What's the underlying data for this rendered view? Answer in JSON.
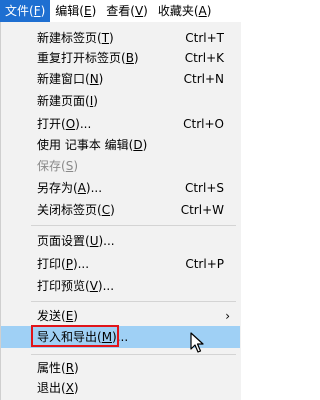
{
  "menubar": [
    {
      "name": "menu-file",
      "label": "文件(",
      "key": "F",
      "close": ")",
      "active": true
    },
    {
      "name": "menu-edit",
      "label": "编辑(",
      "key": "E",
      "close": ")",
      "active": false
    },
    {
      "name": "menu-view",
      "label": "查看(",
      "key": "V",
      "close": ")",
      "active": false
    },
    {
      "name": "menu-favorites",
      "label": "收藏夹(",
      "key": "A",
      "close": ")",
      "active": false
    }
  ],
  "items": [
    {
      "name": "menu-item-new-tab",
      "label": "新建标签页(",
      "key": "T",
      "close": ")",
      "shortcut": "Ctrl+T"
    },
    {
      "name": "menu-item-reopen-tab",
      "label": "重复打开标签页(",
      "key": "B",
      "close": ")",
      "shortcut": "Ctrl+K"
    },
    {
      "name": "menu-item-new-window",
      "label": "新建窗口(",
      "key": "N",
      "close": ")",
      "shortcut": "Ctrl+N"
    },
    {
      "name": "menu-item-new-page",
      "label": "新建页面(",
      "key": "I",
      "close": ")",
      "shortcut": ""
    },
    {
      "name": "menu-item-open",
      "label": "打开(",
      "key": "O",
      "close": ")...",
      "shortcut": "Ctrl+O"
    },
    {
      "name": "menu-item-edit-notepad",
      "label": "使用 记事本 编辑(",
      "key": "D",
      "close": ")",
      "shortcut": ""
    },
    {
      "name": "menu-item-save",
      "label": "保存(",
      "key": "S",
      "close": ")",
      "shortcut": "",
      "disabled": true
    },
    {
      "name": "menu-item-save-as",
      "label": "另存为(",
      "key": "A",
      "close": ")...",
      "shortcut": "Ctrl+S"
    },
    {
      "name": "menu-item-close-tab",
      "label": "关闭标签页(",
      "key": "C",
      "close": ")",
      "shortcut": "Ctrl+W"
    },
    {
      "name": "menu-item-page-setup",
      "label": "页面设置(",
      "key": "U",
      "close": ")...",
      "shortcut": ""
    },
    {
      "name": "menu-item-print",
      "label": "打印(",
      "key": "P",
      "close": ")...",
      "shortcut": "Ctrl+P"
    },
    {
      "name": "menu-item-print-preview",
      "label": "打印预览(",
      "key": "V",
      "close": ")...",
      "shortcut": ""
    },
    {
      "name": "menu-item-send",
      "label": "发送(",
      "key": "E",
      "close": ")",
      "shortcut": "",
      "submenu": true
    },
    {
      "name": "menu-item-import-export",
      "label": "导入和导出(",
      "key": "M",
      "close": ")...",
      "shortcut": "",
      "highlighted": true
    },
    {
      "name": "menu-item-properties",
      "label": "属性(",
      "key": "R",
      "close": ")",
      "shortcut": ""
    },
    {
      "name": "menu-item-exit",
      "label": "退出(",
      "key": "X",
      "close": ")",
      "shortcut": ""
    }
  ],
  "colors": {
    "active_menu": "#1e6fd1",
    "highlight": "#9fd0f5",
    "annotation_box": "#e1151a"
  }
}
